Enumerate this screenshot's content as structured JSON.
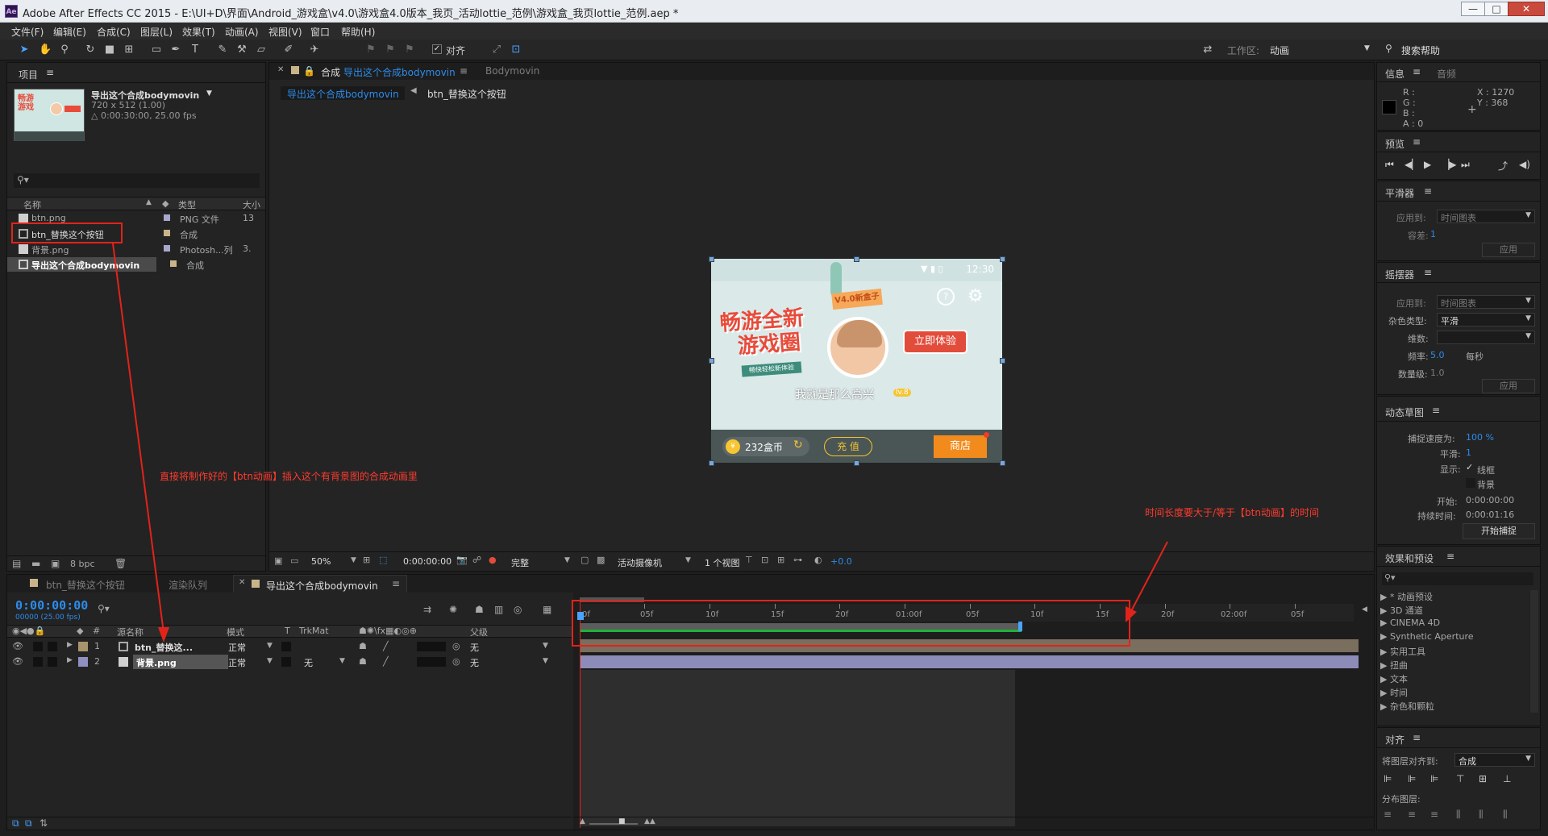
{
  "window": {
    "title": "Adobe After Effects CC 2015 - E:\\UI+D\\界面\\Android_游戏盒\\v4.0\\游戏盒4.0版本_我页_活动lottie_范例\\游戏盒_我页lottie_范例.aep *",
    "app_icon": "Ae",
    "min": "—",
    "max": "□",
    "close": "✕"
  },
  "menu": [
    "文件(F)",
    "编辑(E)",
    "合成(C)",
    "图层(L)",
    "效果(T)",
    "动画(A)",
    "视图(V)",
    "窗口",
    "帮助(H)"
  ],
  "toolbar": {
    "snap_label": "对齐",
    "workspace_label": "工作区:",
    "workspace_value": "动画",
    "search_help": "搜索帮助"
  },
  "project": {
    "tab": "项目",
    "comp_name": "导出这个合成bodymovin",
    "comp_size": "720 x 512 (1.00)",
    "comp_duration": "△ 0:00:30:00, 25.00 fps",
    "cols": {
      "name": "名称",
      "type": "类型",
      "size": "大小"
    },
    "items": [
      {
        "name": "btn.png",
        "type": "PNG 文件",
        "size": "13"
      },
      {
        "name": "btn_替换这个按钮",
        "type": "合成",
        "size": ""
      },
      {
        "name": "背景.png",
        "type": "Photosh...列",
        "size": "3."
      },
      {
        "name": "导出这个合成bodymovin",
        "type": "合成",
        "size": ""
      }
    ],
    "bpc": "8 bpc"
  },
  "annotations": {
    "left": "直接将制作好的【btn动画】插入这个有背景图的合成动画里",
    "right": "时间长度要大于/等于【btn动画】的时间"
  },
  "viewer": {
    "tab_prefix": "合成",
    "tab_name": "导出这个合成bodymovin",
    "tab2": "Bodymovin",
    "crumb1": "导出这个合成bodymovin",
    "crumb2": "btn_替换这个按钮",
    "zoom": "50%",
    "timecode": "0:00:00:00",
    "quality": "完整",
    "camera": "活动摄像机",
    "views": "1 个视图",
    "exposure": "+0.0"
  },
  "artwork": {
    "time": "12:30",
    "badge": "V4.0新盒子",
    "headline1": "畅游全新",
    "headline2": "游戏圈",
    "subline": "畅快轻松新体验",
    "cta": "立即体验",
    "nickname": "我就是那么高兴",
    "level": "lv.8",
    "coins": "232盒币",
    "recharge": "充 值",
    "shop": "商店"
  },
  "timeline": {
    "tabs": [
      "btn_替换这个按钮",
      "渲染队列",
      "导出这个合成bodymovin"
    ],
    "timecode": "0:00:00:00",
    "timecode_sub": "00000 (25.00 fps)",
    "headers": {
      "num": "#",
      "source": "源名称",
      "mode": "模式",
      "t": "T",
      "trkmat": "TrkMat",
      "parent": "父级"
    },
    "layers": [
      {
        "num": "1",
        "name": "btn_替换这...",
        "mode": "正常",
        "trkmat": "",
        "parent": "无"
      },
      {
        "num": "2",
        "name": "背景.png",
        "mode": "正常",
        "trkmat": "无",
        "parent": "无"
      }
    ],
    "ruler": [
      "0f",
      "05f",
      "10f",
      "15f",
      "20f",
      "01:00f",
      "05f",
      "10f",
      "15f",
      "20f",
      "02:00f",
      "05f"
    ]
  },
  "info": {
    "tab1": "信息",
    "tab2": "音频",
    "r": "R :",
    "g": "G :",
    "b": "B :",
    "a": "A : 0",
    "x": "X : 1270",
    "y": "Y : 368"
  },
  "preview": {
    "title": "预览"
  },
  "smoother": {
    "title": "平滑器",
    "apply_to": "应用到:",
    "apply_to_val": "时间图表",
    "tolerance": "容差:",
    "tolerance_val": "1",
    "apply": "应用"
  },
  "wiggler": {
    "title": "摇摆器",
    "apply_to": "应用到:",
    "apply_to_val": "时间图表",
    "noise": "杂色类型:",
    "noise_val": "平滑",
    "dim": "维数:",
    "freq": "频率:",
    "freq_val": "5.0",
    "per_sec": "每秒",
    "mag": "数量级:",
    "mag_val": "1.0",
    "apply": "应用"
  },
  "motion_sketch": {
    "title": "动态草图",
    "capture": "捕捉速度为:",
    "capture_val": "100 %",
    "smooth": "平滑:",
    "smooth_val": "1",
    "show": "显示:",
    "wire": "线框",
    "bg": "背景",
    "start": "开始:",
    "start_val": "0:00:00:00",
    "dur": "持续时间:",
    "dur_val": "0:00:01:16",
    "btn": "开始捕捉"
  },
  "effects": {
    "title": "效果和预设",
    "items": [
      "* 动画预设",
      "3D 通道",
      "CINEMA 4D",
      "Synthetic Aperture",
      "实用工具",
      "扭曲",
      "文本",
      "时间",
      "杂色和颗粒"
    ]
  },
  "align": {
    "title": "对齐",
    "align_to": "将图层对齐到:",
    "align_to_val": "合成",
    "distribute": "分布图层:"
  }
}
